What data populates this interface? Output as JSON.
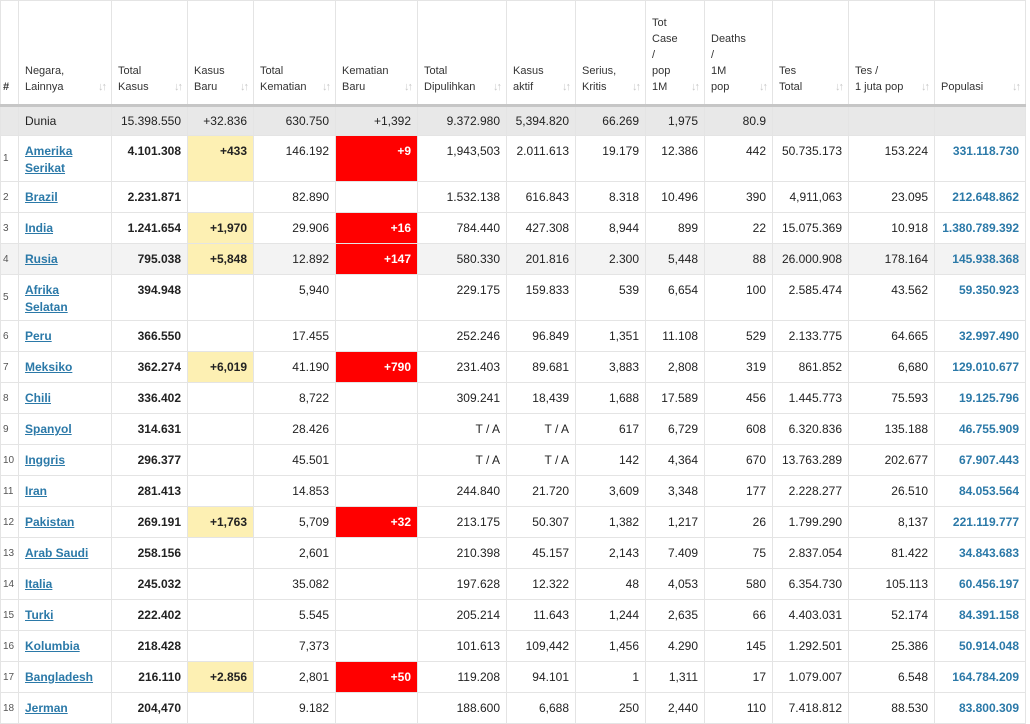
{
  "headers": [
    {
      "key": "num",
      "label": "#"
    },
    {
      "key": "country",
      "label": "Negara,\nLainnya"
    },
    {
      "key": "total_cases",
      "label": "Total\nKasus"
    },
    {
      "key": "new_cases",
      "label": "Kasus\nBaru"
    },
    {
      "key": "total_deaths",
      "label": "Total\nKematian"
    },
    {
      "key": "new_deaths",
      "label": "Kematian\nBaru"
    },
    {
      "key": "recovered",
      "label": "Total\nDipulihkan"
    },
    {
      "key": "active",
      "label": "Kasus\naktif"
    },
    {
      "key": "critical",
      "label": "Serius,\nKritis"
    },
    {
      "key": "cases_per_m",
      "label": "Tot\nCase\n/\npop\n1M"
    },
    {
      "key": "deaths_per_m",
      "label": "Deaths\n/\n1M\npop"
    },
    {
      "key": "tests",
      "label": "Tes\nTotal"
    },
    {
      "key": "tests_per_m",
      "label": "Tes /\n1 juta pop"
    },
    {
      "key": "population",
      "label": "Populasi"
    }
  ],
  "world": {
    "country": "Dunia",
    "total_cases": "15.398.550",
    "new_cases": "+32.836",
    "total_deaths": "630.750",
    "new_deaths": "+1,392",
    "recovered": "9.372.980",
    "active": "5,394.820",
    "critical": "66.269",
    "cases_per_m": "1,975",
    "deaths_per_m": "80.9",
    "tests": "",
    "tests_per_m": "",
    "population": ""
  },
  "rows": [
    {
      "rank": "1",
      "country": "Amerika\nSerikat",
      "total_cases": "4.101.308",
      "new_cases": "+433",
      "total_deaths": "146.192",
      "new_deaths": "+9",
      "recovered": "1,943,503",
      "active": "2.011.613",
      "critical": "19.179",
      "cases_per_m": "12.386",
      "deaths_per_m": "442",
      "tests": "50.735.173",
      "tests_per_m": "153.224",
      "population": "331.118.730"
    },
    {
      "rank": "2",
      "country": "Brazil",
      "total_cases": "2.231.871",
      "new_cases": "",
      "total_deaths": "82.890",
      "new_deaths": "",
      "recovered": "1.532.138",
      "active": "616.843",
      "critical": "8.318",
      "cases_per_m": "10.496",
      "deaths_per_m": "390",
      "tests": "4,911,063",
      "tests_per_m": "23.095",
      "population": "212.648.862"
    },
    {
      "rank": "3",
      "country": "India",
      "total_cases": "1.241.654",
      "new_cases": "+1,970",
      "total_deaths": "29.906",
      "new_deaths": "+16",
      "recovered": "784.440",
      "active": "427.308",
      "critical": "8,944",
      "cases_per_m": "899",
      "deaths_per_m": "22",
      "tests": "15.075.369",
      "tests_per_m": "10.918",
      "population": "1.380.789.392"
    },
    {
      "rank": "4",
      "country": "Rusia",
      "total_cases": "795.038",
      "new_cases": "+5,848",
      "total_deaths": "12.892",
      "new_deaths": "+147",
      "recovered": "580.330",
      "active": "201.816",
      "critical": "2.300",
      "cases_per_m": "5,448",
      "deaths_per_m": "88",
      "tests": "26.000.908",
      "tests_per_m": "178.164",
      "population": "145.938.368"
    },
    {
      "rank": "5",
      "country": "Afrika\nSelatan",
      "total_cases": "394.948",
      "new_cases": "",
      "total_deaths": "5,940",
      "new_deaths": "",
      "recovered": "229.175",
      "active": "159.833",
      "critical": "539",
      "cases_per_m": "6,654",
      "deaths_per_m": "100",
      "tests": "2.585.474",
      "tests_per_m": "43.562",
      "population": "59.350.923"
    },
    {
      "rank": "6",
      "country": "Peru",
      "total_cases": "366.550",
      "new_cases": "",
      "total_deaths": "17.455",
      "new_deaths": "",
      "recovered": "252.246",
      "active": "96.849",
      "critical": "1,351",
      "cases_per_m": "11.108",
      "deaths_per_m": "529",
      "tests": "2.133.775",
      "tests_per_m": "64.665",
      "population": "32.997.490"
    },
    {
      "rank": "7",
      "country": "Meksiko",
      "total_cases": "362.274",
      "new_cases": "+6,019",
      "total_deaths": "41.190",
      "new_deaths": "+790",
      "recovered": "231.403",
      "active": "89.681",
      "critical": "3,883",
      "cases_per_m": "2,808",
      "deaths_per_m": "319",
      "tests": "861.852",
      "tests_per_m": "6,680",
      "population": "129.010.677"
    },
    {
      "rank": "8",
      "country": "Chili",
      "total_cases": "336.402",
      "new_cases": "",
      "total_deaths": "8,722",
      "new_deaths": "",
      "recovered": "309.241",
      "active": "18,439",
      "critical": "1,688",
      "cases_per_m": "17.589",
      "deaths_per_m": "456",
      "tests": "1.445.773",
      "tests_per_m": "75.593",
      "population": "19.125.796"
    },
    {
      "rank": "9",
      "country": "Spanyol",
      "total_cases": "314.631",
      "new_cases": "",
      "total_deaths": "28.426",
      "new_deaths": "",
      "recovered": "T / A",
      "active": "T / A",
      "critical": "617",
      "cases_per_m": "6,729",
      "deaths_per_m": "608",
      "tests": "6.320.836",
      "tests_per_m": "135.188",
      "population": "46.755.909"
    },
    {
      "rank": "10",
      "country": "Inggris",
      "total_cases": "296.377",
      "new_cases": "",
      "total_deaths": "45.501",
      "new_deaths": "",
      "recovered": "T / A",
      "active": "T / A",
      "critical": "142",
      "cases_per_m": "4,364",
      "deaths_per_m": "670",
      "tests": "13.763.289",
      "tests_per_m": "202.677",
      "population": "67.907.443"
    },
    {
      "rank": "11",
      "country": "Iran",
      "total_cases": "281.413",
      "new_cases": "",
      "total_deaths": "14.853",
      "new_deaths": "",
      "recovered": "244.840",
      "active": "21.720",
      "critical": "3,609",
      "cases_per_m": "3,348",
      "deaths_per_m": "177",
      "tests": "2.228.277",
      "tests_per_m": "26.510",
      "population": "84.053.564"
    },
    {
      "rank": "12",
      "country": "Pakistan",
      "total_cases": "269.191",
      "new_cases": "+1,763",
      "total_deaths": "5,709",
      "new_deaths": "+32",
      "recovered": "213.175",
      "active": "50.307",
      "critical": "1,382",
      "cases_per_m": "1,217",
      "deaths_per_m": "26",
      "tests": "1.799.290",
      "tests_per_m": "8,137",
      "population": "221.119.777"
    },
    {
      "rank": "13",
      "country": "Arab Saudi",
      "total_cases": "258.156",
      "new_cases": "",
      "total_deaths": "2,601",
      "new_deaths": "",
      "recovered": "210.398",
      "active": "45.157",
      "critical": "2,143",
      "cases_per_m": "7.409",
      "deaths_per_m": "75",
      "tests": "2.837.054",
      "tests_per_m": "81.422",
      "population": "34.843.683"
    },
    {
      "rank": "14",
      "country": "Italia",
      "total_cases": "245.032",
      "new_cases": "",
      "total_deaths": "35.082",
      "new_deaths": "",
      "recovered": "197.628",
      "active": "12.322",
      "critical": "48",
      "cases_per_m": "4,053",
      "deaths_per_m": "580",
      "tests": "6.354.730",
      "tests_per_m": "105.113",
      "population": "60.456.197"
    },
    {
      "rank": "15",
      "country": "Turki",
      "total_cases": "222.402",
      "new_cases": "",
      "total_deaths": "5.545",
      "new_deaths": "",
      "recovered": "205.214",
      "active": "11.643",
      "critical": "1,244",
      "cases_per_m": "2,635",
      "deaths_per_m": "66",
      "tests": "4.403.031",
      "tests_per_m": "52.174",
      "population": "84.391.158"
    },
    {
      "rank": "16",
      "country": "Kolumbia",
      "total_cases": "218.428",
      "new_cases": "",
      "total_deaths": "7,373",
      "new_deaths": "",
      "recovered": "101.613",
      "active": "109,442",
      "critical": "1,456",
      "cases_per_m": "4.290",
      "deaths_per_m": "145",
      "tests": "1.292.501",
      "tests_per_m": "25.386",
      "population": "50.914.048"
    },
    {
      "rank": "17",
      "country": "Bangladesh",
      "total_cases": "216.110",
      "new_cases": "+2.856",
      "total_deaths": "2,801",
      "new_deaths": "+50",
      "recovered": "119.208",
      "active": "94.101",
      "critical": "1",
      "cases_per_m": "1,311",
      "deaths_per_m": "17",
      "tests": "1.079.007",
      "tests_per_m": "6.548",
      "population": "164.784.209"
    },
    {
      "rank": "18",
      "country": "Jerman",
      "total_cases": "204,470",
      "new_cases": "",
      "total_deaths": "9.182",
      "new_deaths": "",
      "recovered": "188.600",
      "active": "6,688",
      "critical": "250",
      "cases_per_m": "2,440",
      "deaths_per_m": "110",
      "tests": "7.418.812",
      "tests_per_m": "88.530",
      "population": "83.800.309"
    }
  ],
  "colors": {
    "link": "#2b79a8",
    "new_cases_highlight": "#fdf0b3",
    "new_deaths_highlight": "#ff0000",
    "world_row": "#e8e8e8"
  },
  "icons": {
    "sort": "sort-arrows-icon"
  }
}
